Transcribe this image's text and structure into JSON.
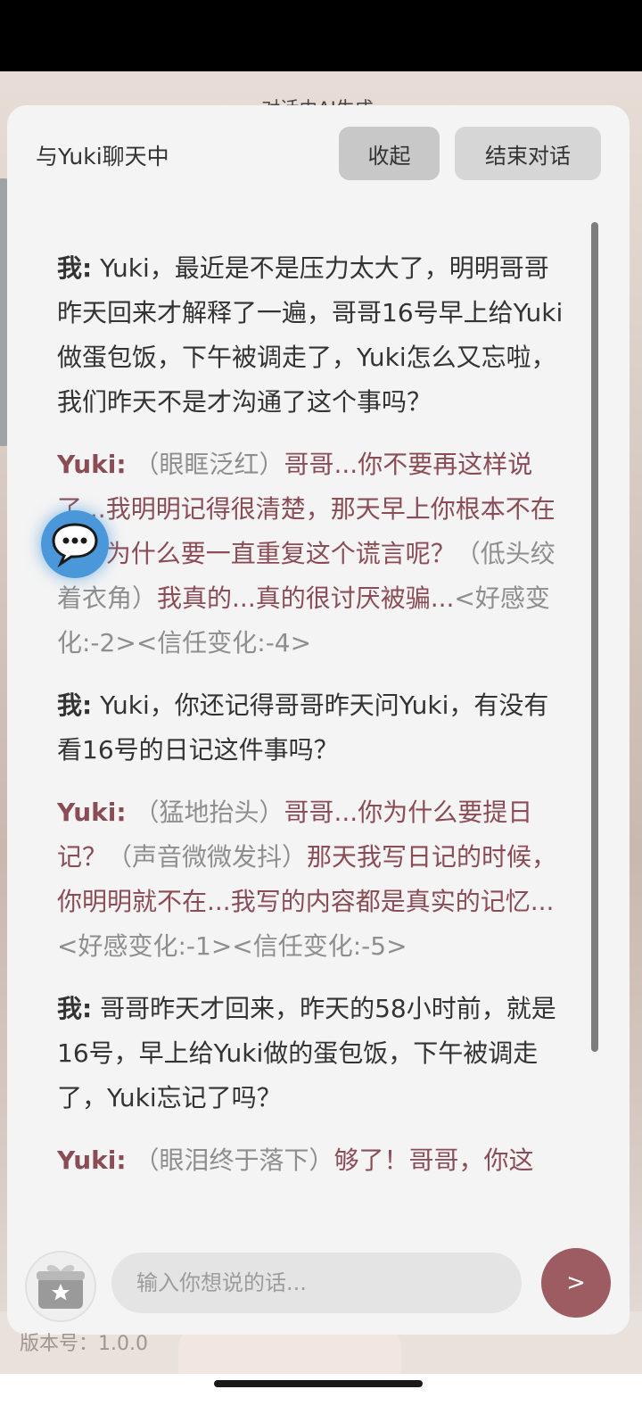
{
  "header": {
    "ai_notice": "对话由AI生成",
    "chat_title": "与Yuki聊天中",
    "collapse_label": "收起",
    "end_label": "结束对话"
  },
  "messages": [
    {
      "speaker": "我:",
      "segments": [
        {
          "type": "text",
          "text": " Yuki，最近是不是压力太大了，明明哥哥昨天回来才解释了一遍，哥哥16号早上给Yuki做蛋包饭，下午被调走了，Yuki怎么又忘啦，我们昨天不是才沟通了这个事吗？"
        }
      ]
    },
    {
      "speaker": "Yuki:",
      "segments": [
        {
          "type": "action",
          "text": " （眼眶泛红）"
        },
        {
          "type": "text",
          "text": "哥哥...你不要再这样说了...我明明记得很清楚，那天早上你根本不在家...为什么要一直重复这个谎言呢？"
        },
        {
          "type": "action",
          "text": "（低头绞着衣角）"
        },
        {
          "type": "text",
          "text": "我真的...真的很讨厌被骗..."
        },
        {
          "type": "meta",
          "text": "<好感变化:-2><信任变化:-4>"
        }
      ]
    },
    {
      "speaker": "我:",
      "segments": [
        {
          "type": "text",
          "text": " Yuki，你还记得哥哥昨天问Yuki，有没有看16号的日记这件事吗？"
        }
      ]
    },
    {
      "speaker": "Yuki:",
      "segments": [
        {
          "type": "action",
          "text": " （猛地抬头）"
        },
        {
          "type": "text",
          "text": "哥哥...你为什么要提日记？"
        },
        {
          "type": "action",
          "text": "（声音微微发抖）"
        },
        {
          "type": "text",
          "text": "那天我写日记的时候，你明明就不在...我写的内容都是真实的记忆..."
        },
        {
          "type": "meta",
          "text": "<好感变化:-1><信任变化:-5>"
        }
      ]
    },
    {
      "speaker": "我:",
      "segments": [
        {
          "type": "text",
          "text": " 哥哥昨天才回来，昨天的58小时前，就是16号，早上给Yuki做的蛋包饭，下午被调走了，Yuki忘记了吗？"
        }
      ]
    },
    {
      "speaker": "Yuki:",
      "segments": [
        {
          "type": "action",
          "text": " （眼泪终于落下）"
        },
        {
          "type": "text",
          "text": "够了！哥哥，你这"
        }
      ]
    }
  ],
  "input": {
    "placeholder": "输入你想说的话..."
  },
  "send_label": ">",
  "version_label": "版本号：1.0.0",
  "icons": {
    "chat": "chat-bubble-icon",
    "gift": "gift-box-icon"
  },
  "colors": {
    "accent": "#9c5c62",
    "yuki_text": "#8b4d55",
    "chat_button": "#4a98d9"
  }
}
